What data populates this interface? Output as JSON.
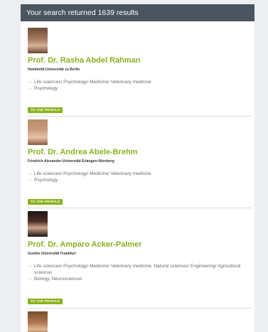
{
  "header": {
    "results_text": "Your search returned 1639 results"
  },
  "profiles": [
    {
      "name": "Prof. Dr. Rasha Abdel Rahman",
      "university": "Humboldt-Universität zu Berlin",
      "fields": [
        "Life sciences/ Psychology/ Medicine/ Veterinary medicine",
        "Psychology"
      ],
      "button": "TO THE PROFILE"
    },
    {
      "name": "Prof. Dr. Andrea Abele-Brehm",
      "university": "Friedrich-Alexander-Universität Erlangen-Nürnberg",
      "fields": [
        "Life sciences/ Psychology/ Medicine/ Veterinary medicine",
        "Psychology"
      ],
      "button": "TO THE PROFILE"
    },
    {
      "name": "Prof. Dr. Amparo Acker-Palmer",
      "university": "Goethe Universität Frankfurt",
      "fields": [
        "Life sciences/ Psychology/ Medicine/ Veterinary medicine, Natural sciences/ Engineering/ Agricultural sciences",
        "Biology, Neurosciences"
      ],
      "button": "TO THE PROFILE"
    }
  ],
  "colors": {
    "accent_green": "#8ab21d",
    "header_bg": "#4a5560"
  },
  "icons": {
    "field_bullet": "arrow-right-icon",
    "avatar": "profile-photo"
  }
}
